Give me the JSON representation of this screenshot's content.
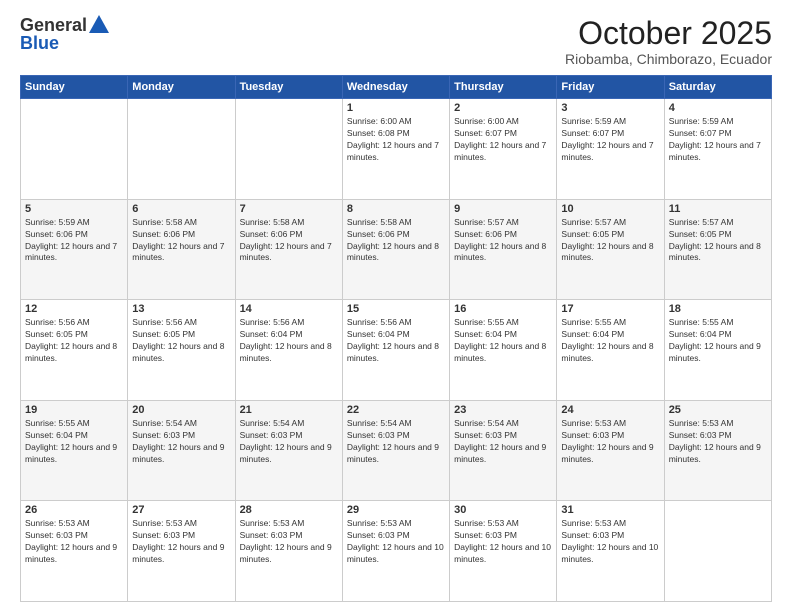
{
  "logo": {
    "general": "General",
    "blue": "Blue"
  },
  "header": {
    "month": "October 2025",
    "location": "Riobamba, Chimborazo, Ecuador"
  },
  "weekdays": [
    "Sunday",
    "Monday",
    "Tuesday",
    "Wednesday",
    "Thursday",
    "Friday",
    "Saturday"
  ],
  "weeks": [
    [
      {
        "day": "",
        "sunrise": "",
        "sunset": "",
        "daylight": ""
      },
      {
        "day": "",
        "sunrise": "",
        "sunset": "",
        "daylight": ""
      },
      {
        "day": "",
        "sunrise": "",
        "sunset": "",
        "daylight": ""
      },
      {
        "day": "1",
        "sunrise": "Sunrise: 6:00 AM",
        "sunset": "Sunset: 6:08 PM",
        "daylight": "Daylight: 12 hours and 7 minutes."
      },
      {
        "day": "2",
        "sunrise": "Sunrise: 6:00 AM",
        "sunset": "Sunset: 6:07 PM",
        "daylight": "Daylight: 12 hours and 7 minutes."
      },
      {
        "day": "3",
        "sunrise": "Sunrise: 5:59 AM",
        "sunset": "Sunset: 6:07 PM",
        "daylight": "Daylight: 12 hours and 7 minutes."
      },
      {
        "day": "4",
        "sunrise": "Sunrise: 5:59 AM",
        "sunset": "Sunset: 6:07 PM",
        "daylight": "Daylight: 12 hours and 7 minutes."
      }
    ],
    [
      {
        "day": "5",
        "sunrise": "Sunrise: 5:59 AM",
        "sunset": "Sunset: 6:06 PM",
        "daylight": "Daylight: 12 hours and 7 minutes."
      },
      {
        "day": "6",
        "sunrise": "Sunrise: 5:58 AM",
        "sunset": "Sunset: 6:06 PM",
        "daylight": "Daylight: 12 hours and 7 minutes."
      },
      {
        "day": "7",
        "sunrise": "Sunrise: 5:58 AM",
        "sunset": "Sunset: 6:06 PM",
        "daylight": "Daylight: 12 hours and 7 minutes."
      },
      {
        "day": "8",
        "sunrise": "Sunrise: 5:58 AM",
        "sunset": "Sunset: 6:06 PM",
        "daylight": "Daylight: 12 hours and 8 minutes."
      },
      {
        "day": "9",
        "sunrise": "Sunrise: 5:57 AM",
        "sunset": "Sunset: 6:06 PM",
        "daylight": "Daylight: 12 hours and 8 minutes."
      },
      {
        "day": "10",
        "sunrise": "Sunrise: 5:57 AM",
        "sunset": "Sunset: 6:05 PM",
        "daylight": "Daylight: 12 hours and 8 minutes."
      },
      {
        "day": "11",
        "sunrise": "Sunrise: 5:57 AM",
        "sunset": "Sunset: 6:05 PM",
        "daylight": "Daylight: 12 hours and 8 minutes."
      }
    ],
    [
      {
        "day": "12",
        "sunrise": "Sunrise: 5:56 AM",
        "sunset": "Sunset: 6:05 PM",
        "daylight": "Daylight: 12 hours and 8 minutes."
      },
      {
        "day": "13",
        "sunrise": "Sunrise: 5:56 AM",
        "sunset": "Sunset: 6:05 PM",
        "daylight": "Daylight: 12 hours and 8 minutes."
      },
      {
        "day": "14",
        "sunrise": "Sunrise: 5:56 AM",
        "sunset": "Sunset: 6:04 PM",
        "daylight": "Daylight: 12 hours and 8 minutes."
      },
      {
        "day": "15",
        "sunrise": "Sunrise: 5:56 AM",
        "sunset": "Sunset: 6:04 PM",
        "daylight": "Daylight: 12 hours and 8 minutes."
      },
      {
        "day": "16",
        "sunrise": "Sunrise: 5:55 AM",
        "sunset": "Sunset: 6:04 PM",
        "daylight": "Daylight: 12 hours and 8 minutes."
      },
      {
        "day": "17",
        "sunrise": "Sunrise: 5:55 AM",
        "sunset": "Sunset: 6:04 PM",
        "daylight": "Daylight: 12 hours and 8 minutes."
      },
      {
        "day": "18",
        "sunrise": "Sunrise: 5:55 AM",
        "sunset": "Sunset: 6:04 PM",
        "daylight": "Daylight: 12 hours and 9 minutes."
      }
    ],
    [
      {
        "day": "19",
        "sunrise": "Sunrise: 5:55 AM",
        "sunset": "Sunset: 6:04 PM",
        "daylight": "Daylight: 12 hours and 9 minutes."
      },
      {
        "day": "20",
        "sunrise": "Sunrise: 5:54 AM",
        "sunset": "Sunset: 6:03 PM",
        "daylight": "Daylight: 12 hours and 9 minutes."
      },
      {
        "day": "21",
        "sunrise": "Sunrise: 5:54 AM",
        "sunset": "Sunset: 6:03 PM",
        "daylight": "Daylight: 12 hours and 9 minutes."
      },
      {
        "day": "22",
        "sunrise": "Sunrise: 5:54 AM",
        "sunset": "Sunset: 6:03 PM",
        "daylight": "Daylight: 12 hours and 9 minutes."
      },
      {
        "day": "23",
        "sunrise": "Sunrise: 5:54 AM",
        "sunset": "Sunset: 6:03 PM",
        "daylight": "Daylight: 12 hours and 9 minutes."
      },
      {
        "day": "24",
        "sunrise": "Sunrise: 5:53 AM",
        "sunset": "Sunset: 6:03 PM",
        "daylight": "Daylight: 12 hours and 9 minutes."
      },
      {
        "day": "25",
        "sunrise": "Sunrise: 5:53 AM",
        "sunset": "Sunset: 6:03 PM",
        "daylight": "Daylight: 12 hours and 9 minutes."
      }
    ],
    [
      {
        "day": "26",
        "sunrise": "Sunrise: 5:53 AM",
        "sunset": "Sunset: 6:03 PM",
        "daylight": "Daylight: 12 hours and 9 minutes."
      },
      {
        "day": "27",
        "sunrise": "Sunrise: 5:53 AM",
        "sunset": "Sunset: 6:03 PM",
        "daylight": "Daylight: 12 hours and 9 minutes."
      },
      {
        "day": "28",
        "sunrise": "Sunrise: 5:53 AM",
        "sunset": "Sunset: 6:03 PM",
        "daylight": "Daylight: 12 hours and 9 minutes."
      },
      {
        "day": "29",
        "sunrise": "Sunrise: 5:53 AM",
        "sunset": "Sunset: 6:03 PM",
        "daylight": "Daylight: 12 hours and 10 minutes."
      },
      {
        "day": "30",
        "sunrise": "Sunrise: 5:53 AM",
        "sunset": "Sunset: 6:03 PM",
        "daylight": "Daylight: 12 hours and 10 minutes."
      },
      {
        "day": "31",
        "sunrise": "Sunrise: 5:53 AM",
        "sunset": "Sunset: 6:03 PM",
        "daylight": "Daylight: 12 hours and 10 minutes."
      },
      {
        "day": "",
        "sunrise": "",
        "sunset": "",
        "daylight": ""
      }
    ]
  ]
}
